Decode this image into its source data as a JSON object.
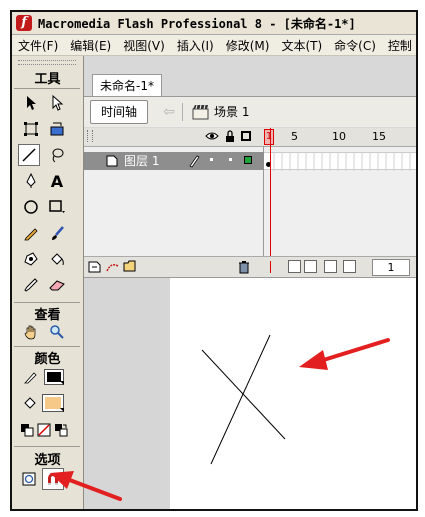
{
  "window": {
    "title": "Macromedia Flash Professional 8 - [未命名-1*]",
    "app_icon_letter": "f"
  },
  "menu": {
    "items": [
      "文件(F)",
      "编辑(E)",
      "视图(V)",
      "插入(I)",
      "修改(M)",
      "文本(T)",
      "命令(C)",
      "控制"
    ]
  },
  "tools_panel": {
    "title": "工具",
    "view_title": "查看",
    "colors_title": "颜色",
    "options_title": "选项",
    "stroke_color": "#000000",
    "fill_color": "#f6c988"
  },
  "document": {
    "tab_label": "未命名-1*",
    "timeline_button": "时间轴",
    "scene_label": "场景 1"
  },
  "timeline": {
    "frame_numbers": [
      "1",
      "5",
      "10",
      "15"
    ],
    "layer_name": "图层 1",
    "current_frame": "1"
  },
  "colors": {
    "playhead": "#e00000",
    "annotation_arrow": "#e32020",
    "selected_layer": "#8e8e8e"
  }
}
